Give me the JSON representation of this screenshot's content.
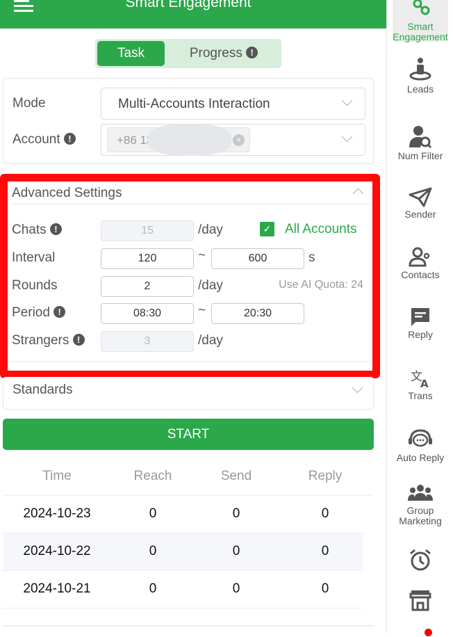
{
  "header": {
    "title": "Smart Engagement",
    "menu_icon": "menu-collapse-icon"
  },
  "tabs": [
    {
      "label": "Task",
      "active": true
    },
    {
      "label": "Progress",
      "active": false
    }
  ],
  "info_glyph": "!",
  "form": {
    "mode_label": "Mode",
    "mode_value": "Multi-Accounts Interaction",
    "account_label": "Account",
    "account_tag": "+86 13"
  },
  "advanced": {
    "title": "Advanced Settings",
    "chats_label": "Chats",
    "chats_value": "15",
    "per_day": "/day",
    "all_accounts_label": "All Accounts",
    "all_accounts_checked": true,
    "interval_label": "Interval",
    "interval_min": "120",
    "tilde": "~",
    "interval_max": "600",
    "seconds_unit": "s",
    "rounds_label": "Rounds",
    "rounds_value": "2",
    "ai_quota": "Use AI Quota: 24",
    "period_label": "Period",
    "period_start": "08:30",
    "period_end": "20:30",
    "strangers_label": "Strangers",
    "strangers_value": "3"
  },
  "standards": {
    "title": "Standards"
  },
  "start_label": "START",
  "table": {
    "headers": [
      "Time",
      "Reach",
      "Send",
      "Reply"
    ],
    "rows": [
      [
        "2024-10-23",
        "0",
        "0",
        "0"
      ],
      [
        "2024-10-22",
        "0",
        "0",
        "0"
      ],
      [
        "2024-10-21",
        "0",
        "0",
        "0"
      ]
    ]
  },
  "sidebar": {
    "items": [
      {
        "label": "Smart Engagement",
        "icon": "share-nodes-icon",
        "active": true
      },
      {
        "label": "Leads",
        "icon": "person-pin-icon"
      },
      {
        "label": "Num Filter",
        "icon": "user-search-icon"
      },
      {
        "label": "Sender",
        "icon": "paper-plane-icon"
      },
      {
        "label": "Contacts",
        "icon": "contacts-icon"
      },
      {
        "label": "Reply",
        "icon": "chat-bubble-icon"
      },
      {
        "label": "Trans",
        "icon": "translate-icon"
      },
      {
        "label": "Auto Reply",
        "icon": "headset-chat-icon"
      },
      {
        "label": "Group Marketing",
        "icon": "group-icon"
      },
      {
        "label": "",
        "icon": "alarm-clock-icon"
      },
      {
        "label": "",
        "icon": "store-icon"
      }
    ]
  },
  "colors": {
    "brand": "#2ba84a",
    "highlight": "#ff0b0b"
  }
}
